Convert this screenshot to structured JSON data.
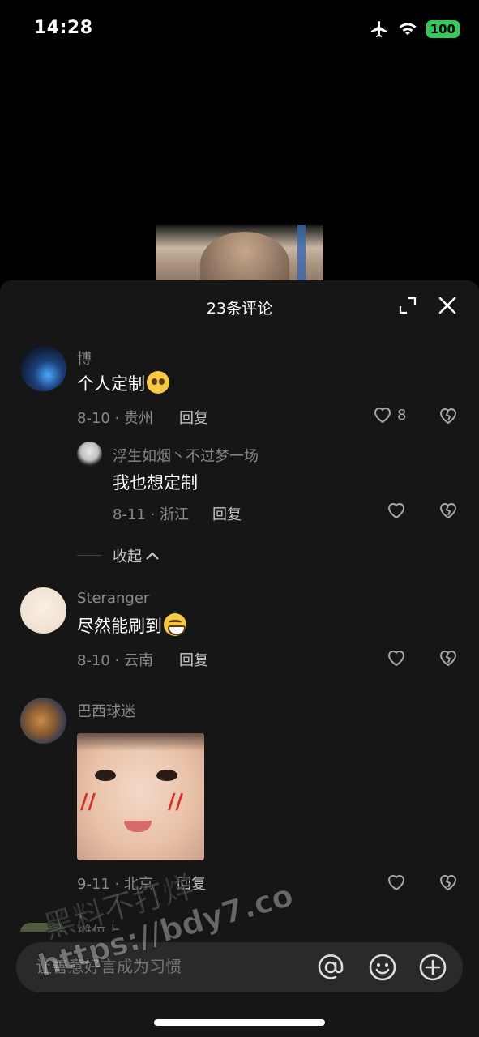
{
  "status_bar": {
    "time": "14:28",
    "battery": "100"
  },
  "panel": {
    "title": "23条评论"
  },
  "comments": [
    {
      "user": "博",
      "text": "个人定制",
      "date_loc": "8-10 · 贵州",
      "reply_label": "回复",
      "likes": "8"
    },
    {
      "user": "Steranger",
      "text": "尽然能刷到",
      "date_loc": "8-10 · 云南",
      "reply_label": "回复"
    },
    {
      "user": "巴西球迷",
      "date_loc": "9-11 · 北京",
      "reply_label": "回复"
    }
  ],
  "sub_reply": {
    "user": "浮生如烟丶不过梦一场",
    "text": "我也想定制",
    "date_loc": "8-11 · 浙江",
    "reply_label": "回复"
  },
  "collapse_label": "收起",
  "partial_next_user": "摊位上",
  "input": {
    "placeholder": "让善意好言成为习惯"
  },
  "watermark": {
    "line1": "黑料不打烊",
    "line2": "https://bdy7.co"
  }
}
